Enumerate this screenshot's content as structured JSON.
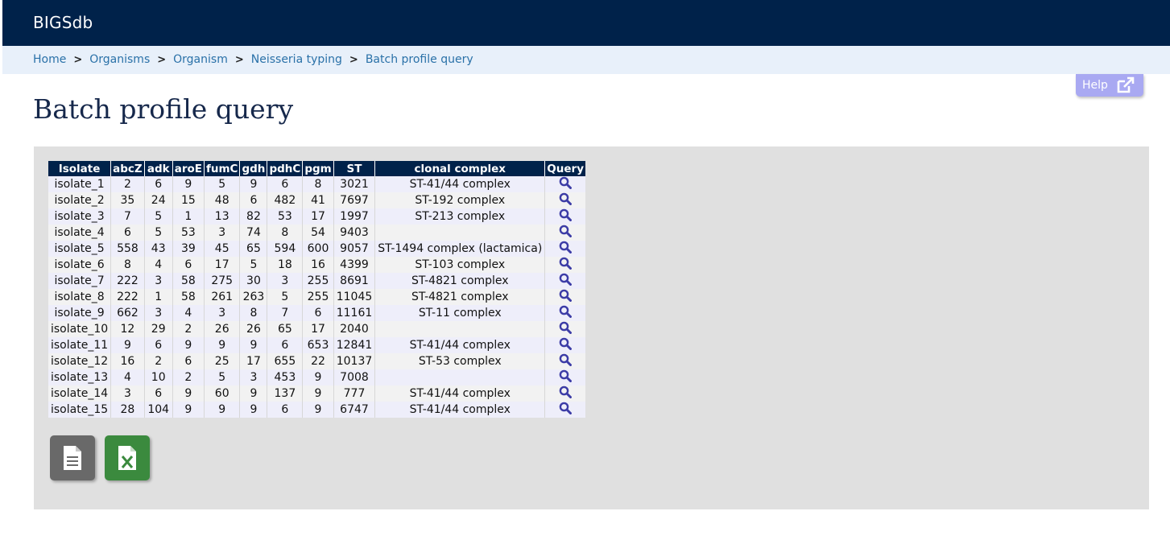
{
  "app": {
    "title": "BIGSdb"
  },
  "breadcrumb": {
    "items": [
      "Home",
      "Organisms",
      "Organism",
      "Neisseria typing",
      "Batch profile query"
    ],
    "separator": ">"
  },
  "help": {
    "label": "Help",
    "icon": "external-link-icon"
  },
  "page": {
    "title": "Batch profile query"
  },
  "table": {
    "columns": [
      "Isolate",
      "abcZ",
      "adk",
      "aroE",
      "fumC",
      "gdh",
      "pdhC",
      "pgm",
      "ST",
      "clonal complex",
      "Query"
    ],
    "rows": [
      [
        "isolate_1",
        "2",
        "6",
        "9",
        "5",
        "9",
        "6",
        "8",
        "3021",
        "ST-41/44 complex"
      ],
      [
        "isolate_2",
        "35",
        "24",
        "15",
        "48",
        "6",
        "482",
        "41",
        "7697",
        "ST-192 complex"
      ],
      [
        "isolate_3",
        "7",
        "5",
        "1",
        "13",
        "82",
        "53",
        "17",
        "1997",
        "ST-213 complex"
      ],
      [
        "isolate_4",
        "6",
        "5",
        "53",
        "3",
        "74",
        "8",
        "54",
        "9403",
        ""
      ],
      [
        "isolate_5",
        "558",
        "43",
        "39",
        "45",
        "65",
        "594",
        "600",
        "9057",
        "ST-1494 complex (lactamica)"
      ],
      [
        "isolate_6",
        "8",
        "4",
        "6",
        "17",
        "5",
        "18",
        "16",
        "4399",
        "ST-103 complex"
      ],
      [
        "isolate_7",
        "222",
        "3",
        "58",
        "275",
        "30",
        "3",
        "255",
        "8691",
        "ST-4821 complex"
      ],
      [
        "isolate_8",
        "222",
        "1",
        "58",
        "261",
        "263",
        "5",
        "255",
        "11045",
        "ST-4821 complex"
      ],
      [
        "isolate_9",
        "662",
        "3",
        "4",
        "3",
        "8",
        "7",
        "6",
        "11161",
        "ST-11 complex"
      ],
      [
        "isolate_10",
        "12",
        "29",
        "2",
        "26",
        "26",
        "65",
        "17",
        "2040",
        ""
      ],
      [
        "isolate_11",
        "9",
        "6",
        "9",
        "9",
        "9",
        "6",
        "653",
        "12841",
        "ST-41/44 complex"
      ],
      [
        "isolate_12",
        "16",
        "2",
        "6",
        "25",
        "17",
        "655",
        "22",
        "10137",
        "ST-53 complex"
      ],
      [
        "isolate_13",
        "4",
        "10",
        "2",
        "5",
        "3",
        "453",
        "9",
        "7008",
        ""
      ],
      [
        "isolate_14",
        "3",
        "6",
        "9",
        "60",
        "9",
        "137",
        "9",
        "777",
        "ST-41/44 complex"
      ],
      [
        "isolate_15",
        "28",
        "104",
        "9",
        "9",
        "9",
        "6",
        "9",
        "6747",
        "ST-41/44 complex"
      ]
    ],
    "query_icon": "search-icon"
  },
  "exports": [
    {
      "name": "export-text-button",
      "icon": "text-file-icon",
      "color": "#696969"
    },
    {
      "name": "export-excel-button",
      "icon": "excel-file-icon",
      "color": "#3b8a3e"
    }
  ],
  "colors": {
    "header_bg": "#00224a",
    "breadcrumb_bg": "#e8f0fa",
    "link": "#2a71a8",
    "help_bg": "#a9a9f2",
    "panel_bg": "#e0e0e0",
    "row_odd": "#eeeefa",
    "row_even": "#f2f2f2",
    "query_icon": "#3c3ca6"
  }
}
